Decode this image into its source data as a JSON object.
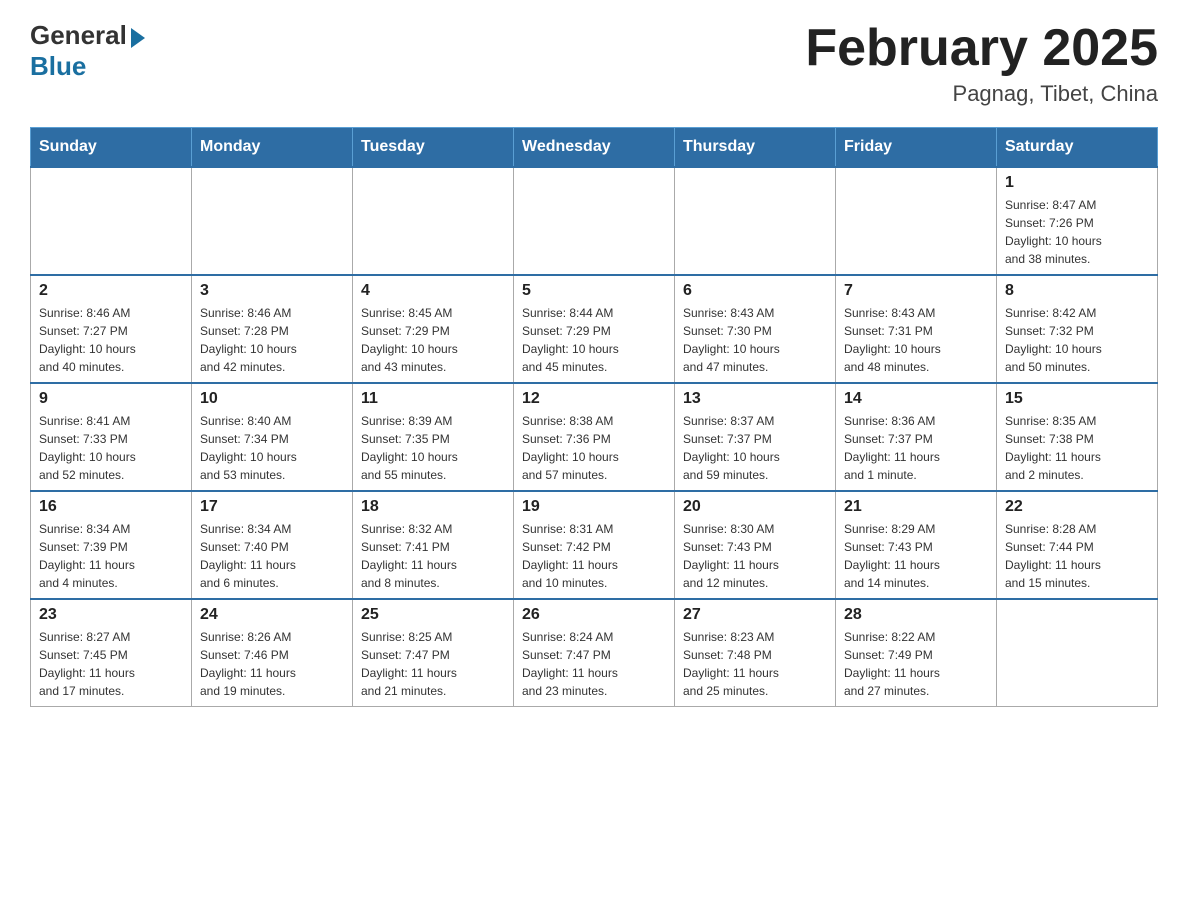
{
  "header": {
    "logo_general": "General",
    "logo_blue": "Blue",
    "title": "February 2025",
    "location": "Pagnag, Tibet, China"
  },
  "weekdays": [
    "Sunday",
    "Monday",
    "Tuesday",
    "Wednesday",
    "Thursday",
    "Friday",
    "Saturday"
  ],
  "weeks": [
    [
      {
        "day": "",
        "info": ""
      },
      {
        "day": "",
        "info": ""
      },
      {
        "day": "",
        "info": ""
      },
      {
        "day": "",
        "info": ""
      },
      {
        "day": "",
        "info": ""
      },
      {
        "day": "",
        "info": ""
      },
      {
        "day": "1",
        "info": "Sunrise: 8:47 AM\nSunset: 7:26 PM\nDaylight: 10 hours\nand 38 minutes."
      }
    ],
    [
      {
        "day": "2",
        "info": "Sunrise: 8:46 AM\nSunset: 7:27 PM\nDaylight: 10 hours\nand 40 minutes."
      },
      {
        "day": "3",
        "info": "Sunrise: 8:46 AM\nSunset: 7:28 PM\nDaylight: 10 hours\nand 42 minutes."
      },
      {
        "day": "4",
        "info": "Sunrise: 8:45 AM\nSunset: 7:29 PM\nDaylight: 10 hours\nand 43 minutes."
      },
      {
        "day": "5",
        "info": "Sunrise: 8:44 AM\nSunset: 7:29 PM\nDaylight: 10 hours\nand 45 minutes."
      },
      {
        "day": "6",
        "info": "Sunrise: 8:43 AM\nSunset: 7:30 PM\nDaylight: 10 hours\nand 47 minutes."
      },
      {
        "day": "7",
        "info": "Sunrise: 8:43 AM\nSunset: 7:31 PM\nDaylight: 10 hours\nand 48 minutes."
      },
      {
        "day": "8",
        "info": "Sunrise: 8:42 AM\nSunset: 7:32 PM\nDaylight: 10 hours\nand 50 minutes."
      }
    ],
    [
      {
        "day": "9",
        "info": "Sunrise: 8:41 AM\nSunset: 7:33 PM\nDaylight: 10 hours\nand 52 minutes."
      },
      {
        "day": "10",
        "info": "Sunrise: 8:40 AM\nSunset: 7:34 PM\nDaylight: 10 hours\nand 53 minutes."
      },
      {
        "day": "11",
        "info": "Sunrise: 8:39 AM\nSunset: 7:35 PM\nDaylight: 10 hours\nand 55 minutes."
      },
      {
        "day": "12",
        "info": "Sunrise: 8:38 AM\nSunset: 7:36 PM\nDaylight: 10 hours\nand 57 minutes."
      },
      {
        "day": "13",
        "info": "Sunrise: 8:37 AM\nSunset: 7:37 PM\nDaylight: 10 hours\nand 59 minutes."
      },
      {
        "day": "14",
        "info": "Sunrise: 8:36 AM\nSunset: 7:37 PM\nDaylight: 11 hours\nand 1 minute."
      },
      {
        "day": "15",
        "info": "Sunrise: 8:35 AM\nSunset: 7:38 PM\nDaylight: 11 hours\nand 2 minutes."
      }
    ],
    [
      {
        "day": "16",
        "info": "Sunrise: 8:34 AM\nSunset: 7:39 PM\nDaylight: 11 hours\nand 4 minutes."
      },
      {
        "day": "17",
        "info": "Sunrise: 8:34 AM\nSunset: 7:40 PM\nDaylight: 11 hours\nand 6 minutes."
      },
      {
        "day": "18",
        "info": "Sunrise: 8:32 AM\nSunset: 7:41 PM\nDaylight: 11 hours\nand 8 minutes."
      },
      {
        "day": "19",
        "info": "Sunrise: 8:31 AM\nSunset: 7:42 PM\nDaylight: 11 hours\nand 10 minutes."
      },
      {
        "day": "20",
        "info": "Sunrise: 8:30 AM\nSunset: 7:43 PM\nDaylight: 11 hours\nand 12 minutes."
      },
      {
        "day": "21",
        "info": "Sunrise: 8:29 AM\nSunset: 7:43 PM\nDaylight: 11 hours\nand 14 minutes."
      },
      {
        "day": "22",
        "info": "Sunrise: 8:28 AM\nSunset: 7:44 PM\nDaylight: 11 hours\nand 15 minutes."
      }
    ],
    [
      {
        "day": "23",
        "info": "Sunrise: 8:27 AM\nSunset: 7:45 PM\nDaylight: 11 hours\nand 17 minutes."
      },
      {
        "day": "24",
        "info": "Sunrise: 8:26 AM\nSunset: 7:46 PM\nDaylight: 11 hours\nand 19 minutes."
      },
      {
        "day": "25",
        "info": "Sunrise: 8:25 AM\nSunset: 7:47 PM\nDaylight: 11 hours\nand 21 minutes."
      },
      {
        "day": "26",
        "info": "Sunrise: 8:24 AM\nSunset: 7:47 PM\nDaylight: 11 hours\nand 23 minutes."
      },
      {
        "day": "27",
        "info": "Sunrise: 8:23 AM\nSunset: 7:48 PM\nDaylight: 11 hours\nand 25 minutes."
      },
      {
        "day": "28",
        "info": "Sunrise: 8:22 AM\nSunset: 7:49 PM\nDaylight: 11 hours\nand 27 minutes."
      },
      {
        "day": "",
        "info": ""
      }
    ]
  ]
}
